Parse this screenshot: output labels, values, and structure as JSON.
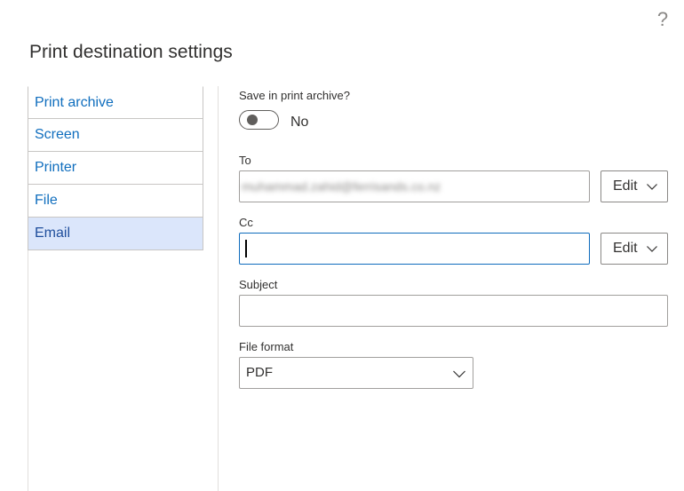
{
  "dialog": {
    "title": "Print destination settings",
    "help_glyph": "?"
  },
  "nav": {
    "items": [
      {
        "label": "Print archive",
        "selected": false
      },
      {
        "label": "Screen",
        "selected": false
      },
      {
        "label": "Printer",
        "selected": false
      },
      {
        "label": "File",
        "selected": false
      },
      {
        "label": "Email",
        "selected": true
      }
    ]
  },
  "email_form": {
    "save_archive": {
      "label": "Save in print archive?",
      "state_label": "No",
      "on": false
    },
    "to": {
      "label": "To",
      "value": "muhammad.zahid@ferrisands.co.nz",
      "edit_label": "Edit"
    },
    "cc": {
      "label": "Cc",
      "value": "",
      "edit_label": "Edit"
    },
    "subject": {
      "label": "Subject",
      "value": ""
    },
    "file_format": {
      "label": "File format",
      "selected": "PDF"
    }
  },
  "icons": {
    "help": "question-mark-icon",
    "chevron": "chevron-down-icon"
  }
}
